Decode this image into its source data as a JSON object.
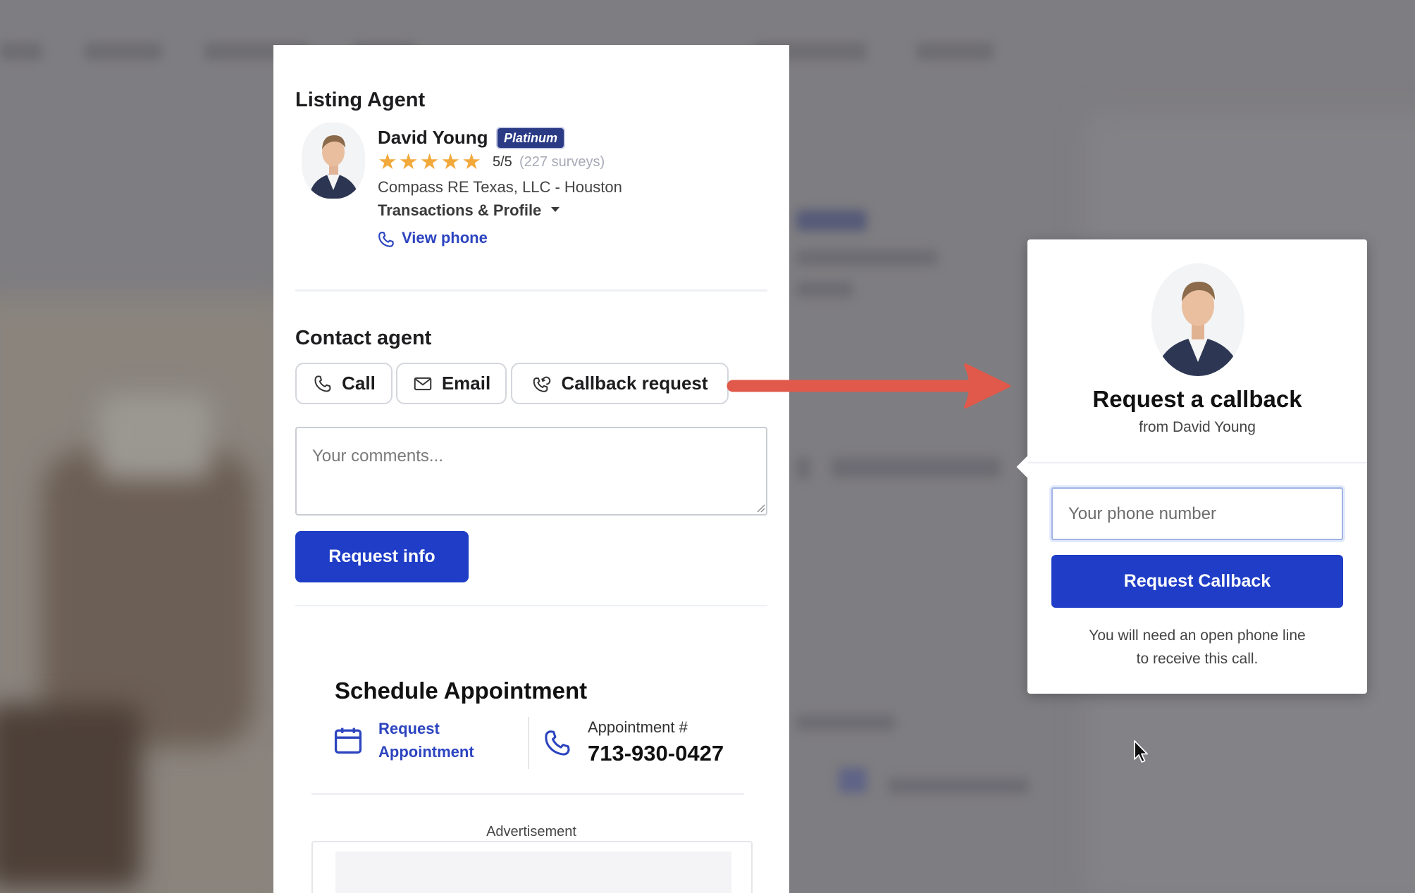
{
  "listing_agent": {
    "section_title": "Listing Agent",
    "name": "David Young",
    "badge": "Platinum",
    "rating": "5/5",
    "surveys": "(227 surveys)",
    "stars_filled": 5,
    "stars_total": 5,
    "company": "Compass RE Texas, LLC - Houston",
    "transactions_label": "Transactions & Profile",
    "view_phone_label": "View phone"
  },
  "contact": {
    "section_title": "Contact agent",
    "tabs": [
      {
        "label": "Call",
        "icon": "phone-icon"
      },
      {
        "label": "Email",
        "icon": "envelope-icon"
      },
      {
        "label": "Callback request",
        "icon": "callback-phone-icon"
      }
    ],
    "comments_placeholder": "Your comments...",
    "submit_label": "Request info"
  },
  "schedule": {
    "title": "Schedule Appointment",
    "request_line1": "Request",
    "request_line2": "Appointment",
    "appointment_label": "Appointment #",
    "appointment_number": "713-930-0427"
  },
  "advertisement": {
    "label": "Advertisement"
  },
  "callback_popup": {
    "title": "Request a callback",
    "subtitle": "from David Young",
    "phone_placeholder": "Your phone number",
    "button_label": "Request Callback",
    "note_line1": "You will need an open phone line",
    "note_line2": "to receive this call."
  },
  "colors": {
    "accent": "#1f3dc6",
    "link": "#2c44bf",
    "badge": "#2a3a85",
    "star": "#f2a93b",
    "arrow": "#e0594a",
    "overlay": "#7e7d81"
  }
}
